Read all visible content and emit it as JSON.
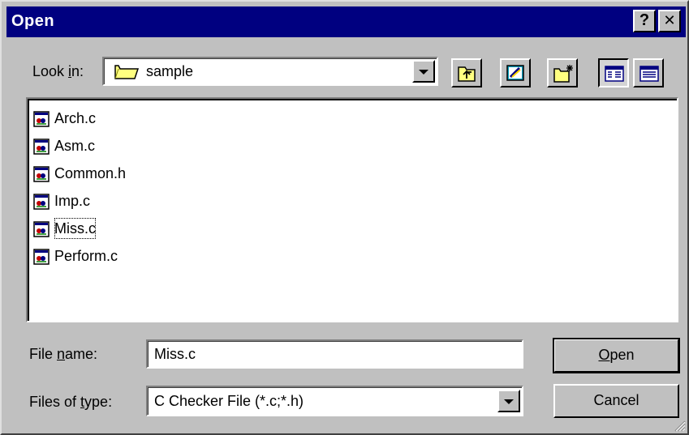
{
  "window": {
    "title": "Open",
    "help_label": "?",
    "close_label": "✕"
  },
  "lookin": {
    "label_pre": "Look ",
    "label_ul": "i",
    "label_post": "n:",
    "value": "sample"
  },
  "toolbar": {
    "buttons": [
      "up-one-level",
      "desktop",
      "create-new-folder",
      "list-view",
      "details-view"
    ],
    "active": "list-view"
  },
  "files": [
    {
      "name": "Arch.c"
    },
    {
      "name": "Asm.c"
    },
    {
      "name": "Common.h"
    },
    {
      "name": "Imp.c"
    },
    {
      "name": "Miss.c"
    },
    {
      "name": "Perform.c"
    }
  ],
  "focused_file": "Miss.c",
  "filename": {
    "label_pre": "File ",
    "label_ul": "n",
    "label_post": "ame:",
    "value": "Miss.c"
  },
  "filetype": {
    "label_pre": "Files of ",
    "label_ul": "t",
    "label_post": "ype:",
    "value": "C Checker File (*.c;*.h)"
  },
  "buttons": {
    "open_ul": "O",
    "open_rest": "pen",
    "cancel": "Cancel"
  }
}
